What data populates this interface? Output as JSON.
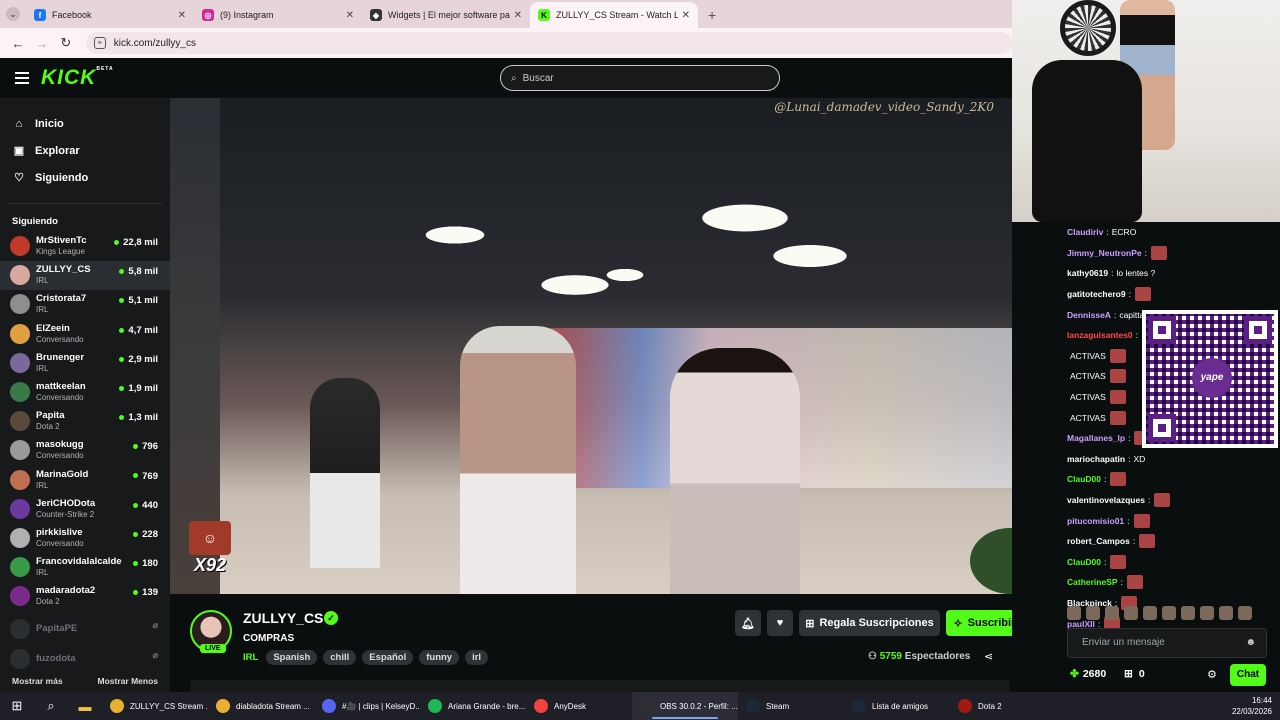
{
  "browser": {
    "tabs": [
      {
        "label": "Facebook",
        "icon": "facebook-icon",
        "color": "#1877f2"
      },
      {
        "label": "(9) Instagram",
        "icon": "instagram-icon",
        "color": "#d6249f"
      },
      {
        "label": "Widgets | El mejor software pa",
        "icon": "widgets-icon",
        "color": "#333333"
      },
      {
        "label": "ZULLYY_CS Stream - Watch Live",
        "icon": "kick-icon",
        "color": "#53fc18"
      }
    ],
    "url": "kick.com/zullyy_cs"
  },
  "header": {
    "logo": "KICK",
    "logo_badge": "BETA",
    "search_placeholder": "Buscar"
  },
  "sidebar": {
    "nav": [
      {
        "label": "Inicio",
        "icon": "home-icon"
      },
      {
        "label": "Explorar",
        "icon": "browse-icon"
      },
      {
        "label": "Siguiendo",
        "icon": "heart-icon"
      }
    ],
    "following_title": "Siguiendo",
    "channels": [
      {
        "name": "MrStivenTc",
        "category": "Kings League",
        "viewers": "22,8 mil",
        "color": "#c0392b"
      },
      {
        "name": "ZULLYY_CS",
        "category": "IRL",
        "viewers": "5,8 mil",
        "color": "#d9a8a0"
      },
      {
        "name": "Cristorata7",
        "category": "IRL",
        "viewers": "5,1 mil",
        "color": "#8e8e8e"
      },
      {
        "name": "ElZeein",
        "category": "Conversando",
        "viewers": "4,7 mil",
        "color": "#e0a040"
      },
      {
        "name": "Brunenger",
        "category": "IRL",
        "viewers": "2,9 mil",
        "color": "#7a6a9a"
      },
      {
        "name": "mattkeelan",
        "category": "Conversando",
        "viewers": "1,9 mil",
        "color": "#3a7a4a"
      },
      {
        "name": "Papita",
        "category": "Dota 2",
        "viewers": "1,3 mil",
        "color": "#5a4a3a"
      },
      {
        "name": "masokugg",
        "category": "Conversando",
        "viewers": "796",
        "color": "#9a9a9a"
      },
      {
        "name": "MarinaGold",
        "category": "IRL",
        "viewers": "769",
        "color": "#c07050"
      },
      {
        "name": "JeriCHODota",
        "category": "Counter-Strike 2",
        "viewers": "440",
        "color": "#6a3aa0"
      },
      {
        "name": "pirkkislive",
        "category": "Conversando",
        "viewers": "228",
        "color": "#b0b0b0"
      },
      {
        "name": "Francovidalalcalde",
        "category": "IRL",
        "viewers": "180",
        "color": "#3a9a4a"
      },
      {
        "name": "madaradota2",
        "category": "Dota 2",
        "viewers": "139",
        "color": "#7a2a8a"
      }
    ],
    "offline": [
      {
        "name": "PapitaPE",
        "icon": "offline-icon"
      },
      {
        "name": "fuzodota",
        "icon": "offline-icon"
      }
    ],
    "show_more": "Mostrar más",
    "show_less": "Mostrar Menos"
  },
  "video": {
    "watermark": "@Lunai_damadev_video_Sandy_2K0",
    "overlay_count": "X92"
  },
  "stream": {
    "username": "ZULLYY_CS",
    "live_label": "LIVE",
    "title": "COMPRAS",
    "category": "IRL",
    "tags": [
      "Spanish",
      "chill",
      "Español",
      "funny",
      "irl"
    ],
    "gift_label": "Regala Suscripciones",
    "subscribe_label": "Suscribirse",
    "viewer_count": "5759",
    "viewer_label": "Espectadores"
  },
  "chat": {
    "messages": [
      {
        "user": "Claudiriv",
        "text": "ECRO",
        "color": "#c8a0ff",
        "emote": false
      },
      {
        "user": "Jimmy_NeutronPe",
        "text": "",
        "color": "#c8a0ff",
        "emote": true
      },
      {
        "user": "kathy0619",
        "text": "lo lentes ?",
        "color": "#ffffff",
        "emote": false
      },
      {
        "user": "gatitotechero9",
        "text": "",
        "color": "#ffffff",
        "emote": true
      },
      {
        "user": "DennisseA",
        "text": "capittanaaa tia romi",
        "color": "#c8a0ff",
        "emote": false
      },
      {
        "user": "lanzaguisantes0",
        "text": "",
        "color": "#ff4a4a",
        "emote": true
      },
      {
        "user": "",
        "text": "ACTIVAS",
        "color": "#ffffff",
        "emote": true
      },
      {
        "user": "",
        "text": "ACTIVAS",
        "color": "#ffffff",
        "emote": true
      },
      {
        "user": "",
        "text": "ACTIVAS",
        "color": "#ffffff",
        "emote": true
      },
      {
        "user": "",
        "text": "ACTIVAS",
        "color": "#ffffff",
        "emote": true
      },
      {
        "user": "Magallanes_lp",
        "text": "",
        "color": "#c8a0ff",
        "emote": true
      },
      {
        "user": "mariochapatin",
        "text": "XD",
        "color": "#ffffff",
        "emote": false
      },
      {
        "user": "ClauD00",
        "text": "",
        "color": "#53fc18",
        "emote": true
      },
      {
        "user": "valentinovelazques",
        "text": "",
        "color": "#ffffff",
        "emote": true
      },
      {
        "user": "pitucomisio01",
        "text": "",
        "color": "#c8a0ff",
        "emote": true
      },
      {
        "user": "robert_Campos",
        "text": "",
        "color": "#ffffff",
        "emote": true
      },
      {
        "user": "ClauD00",
        "text": "",
        "color": "#53fc18",
        "emote": true
      },
      {
        "user": "CatherineSP",
        "text": "",
        "color": "#53fc18",
        "emote": true
      },
      {
        "user": "Blackpinck",
        "text": "",
        "color": "#ffffff",
        "emote": true
      },
      {
        "user": "paulXII",
        "text": "",
        "color": "#c8a0ff",
        "emote": true
      }
    ],
    "input_placeholder": "Enviar un mensaje",
    "points": "2680",
    "gifts": "0",
    "send_label": "Chat"
  },
  "qr": {
    "brand": "yape",
    "color": "#5b1f83"
  },
  "taskbar": {
    "apps": [
      {
        "label": "ZULLYY_CS Stream ...",
        "icon": "chrome-icon",
        "color": "#e8b030",
        "active": false
      },
      {
        "label": "diabladota Stream ...",
        "icon": "chrome-icon",
        "color": "#e8b030",
        "active": false
      },
      {
        "label": "#🎥 | clips | KelseyD...",
        "icon": "discord-icon",
        "color": "#5865f2",
        "active": false
      },
      {
        "label": "Ariana Grande - bre...",
        "icon": "spotify-icon",
        "color": "#1db954",
        "active": false
      },
      {
        "label": "AnyDesk",
        "icon": "anydesk-icon",
        "color": "#ef443b",
        "active": false
      },
      {
        "label": "OBS 30.0.2 - Perfil: ...",
        "icon": "obs-icon",
        "color": "#302e31",
        "active": true
      },
      {
        "label": "Steam",
        "icon": "steam-icon",
        "color": "#1b2838",
        "active": false
      },
      {
        "label": "Lista de amigos",
        "icon": "steam-icon",
        "color": "#1b2838",
        "active": false
      },
      {
        "label": "Dota 2",
        "icon": "dota-icon",
        "color": "#a01a10",
        "active": false
      }
    ],
    "time": "16:44",
    "date": "22/03/2026"
  }
}
